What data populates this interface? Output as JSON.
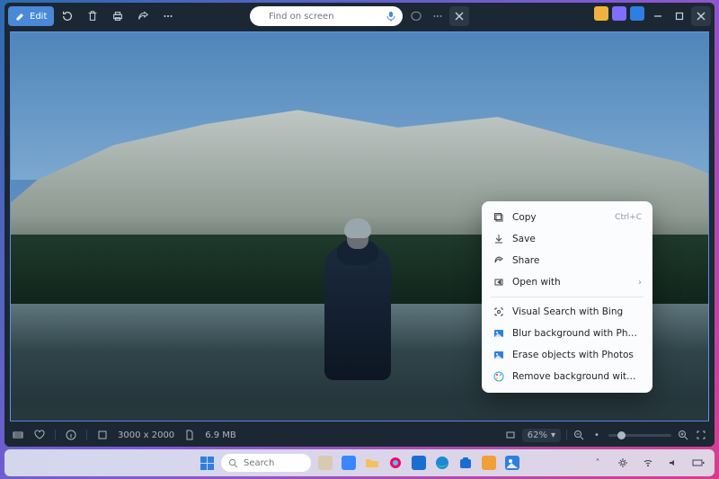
{
  "toolbar": {
    "edit_label": "Edit",
    "search_placeholder": "Find on screen"
  },
  "context_menu": {
    "copy": "Copy",
    "copy_shortcut": "Ctrl+C",
    "save": "Save",
    "share": "Share",
    "open_with": "Open with",
    "visual_search": "Visual Search with Bing",
    "blur_bg": "Blur background with Photos",
    "erase_objects": "Erase objects with Photos",
    "remove_bg": "Remove background with Paint"
  },
  "status": {
    "dimensions": "3000 x 2000",
    "filesize": "6.9 MB",
    "zoom": "62%"
  },
  "taskbar": {
    "search_placeholder": "Search"
  }
}
